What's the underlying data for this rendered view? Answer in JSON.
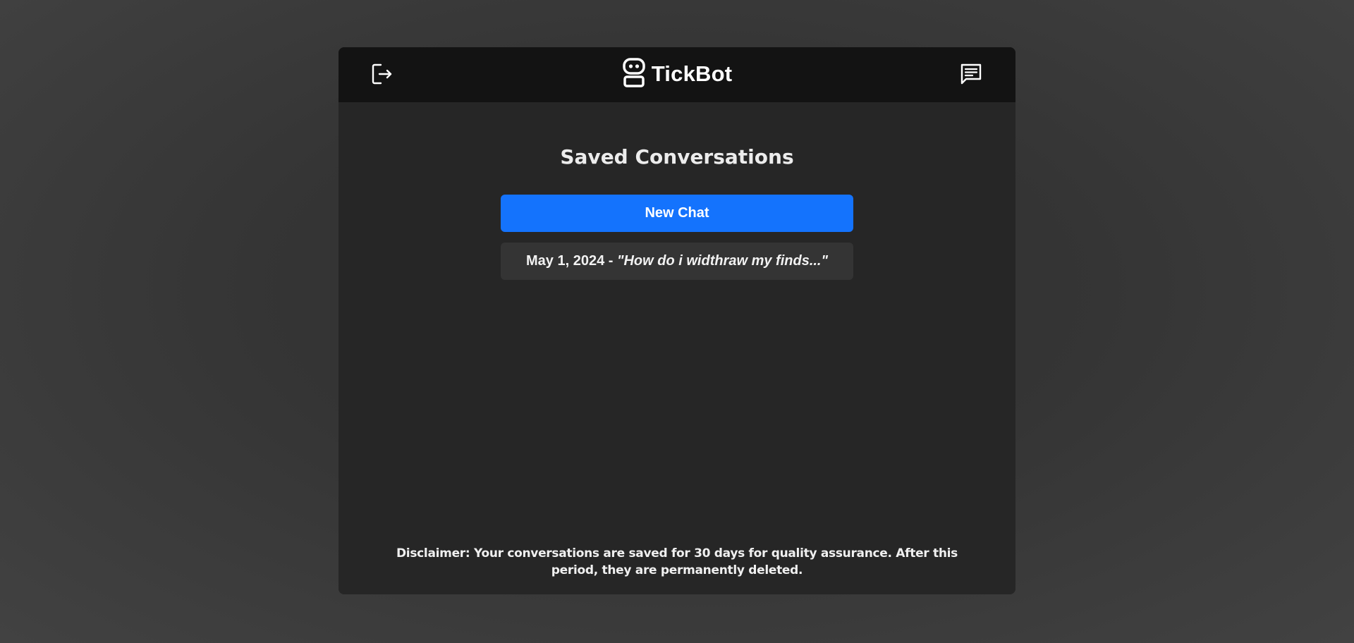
{
  "app": {
    "name": "TickBot",
    "logo_icon": "robot-icon"
  },
  "header": {
    "logout_icon": "logout-icon",
    "chat_icon": "chat-icon"
  },
  "main": {
    "title": "Saved Conversations",
    "new_chat_label": "New Chat",
    "conversations": [
      {
        "date": "May 1, 2024",
        "separator": " - ",
        "preview": "\"How do i widthraw my finds...\""
      }
    ],
    "disclaimer": "Disclaimer: Your conversations are saved for 30 days for quality assurance. After this period, they are permanently deleted."
  },
  "colors": {
    "page_background": "#3a3a3a",
    "panel": "#262626",
    "header": "#131313",
    "accent": "#1473fd",
    "conversation_item": "#343434",
    "text": "#ffffff"
  }
}
